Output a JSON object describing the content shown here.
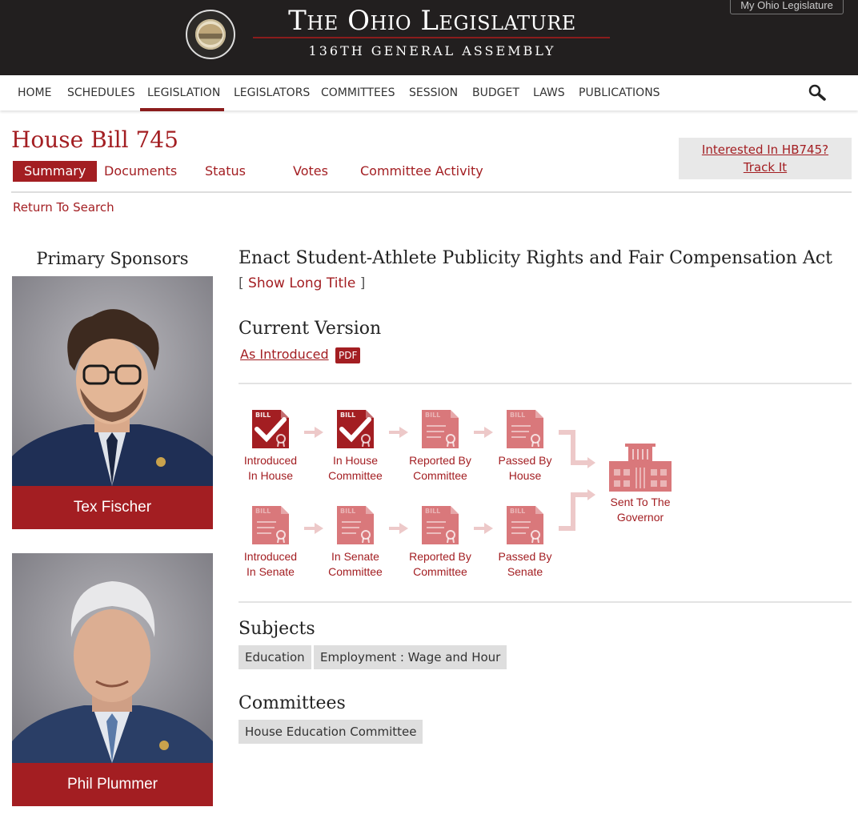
{
  "header": {
    "title": "The Ohio Legislature",
    "subtitle": "136TH GENERAL ASSEMBLY",
    "account_link": "My Ohio Legislature"
  },
  "nav": {
    "items": [
      "HOME",
      "SCHEDULES",
      "LEGISLATION",
      "LEGISLATORS",
      "COMMITTEES",
      "SESSION",
      "BUDGET",
      "LAWS",
      "PUBLICATIONS"
    ],
    "active": "LEGISLATION"
  },
  "bill": {
    "title": "House Bill 745",
    "tabs": [
      "Summary",
      "Documents",
      "Status",
      "Votes",
      "Committee Activity"
    ],
    "active_tab": "Summary",
    "track": {
      "line1": "Interested In HB745?",
      "line2": "Track It"
    },
    "return_link": "Return To Search"
  },
  "sponsors": {
    "heading": "Primary Sponsors",
    "people": [
      {
        "name": "Tex Fischer"
      },
      {
        "name": "Phil Plummer"
      }
    ]
  },
  "summary": {
    "short_title": "Enact Student-Athlete Publicity Rights and Fair Compensation Act",
    "long_title_open": "[",
    "long_title_link": "Show Long Title",
    "long_title_close": "]",
    "current_version_heading": "Current Version",
    "version_link": "As Introduced",
    "pdf_badge": "PDF"
  },
  "status": {
    "house": [
      {
        "line1": "Introduced",
        "line2": "In House",
        "complete": true
      },
      {
        "line1": "In House",
        "line2": "Committee",
        "complete": true
      },
      {
        "line1": "Reported By",
        "line2": "Committee",
        "complete": false
      },
      {
        "line1": "Passed By",
        "line2": "House",
        "complete": false
      }
    ],
    "senate": [
      {
        "line1": "Introduced",
        "line2": "In Senate",
        "complete": false
      },
      {
        "line1": "In Senate",
        "line2": "Committee",
        "complete": false
      },
      {
        "line1": "Reported By",
        "line2": "Committee",
        "complete": false
      },
      {
        "line1": "Passed By",
        "line2": "Senate",
        "complete": false
      }
    ],
    "final": {
      "line1": "Sent To The",
      "line2": "Governor",
      "complete": false
    },
    "icon_text": "BILL",
    "colors": {
      "complete": "#a31e22",
      "pending": "#d9787b",
      "arrow": "#edc9c9"
    }
  },
  "subjects": {
    "heading": "Subjects",
    "tags": [
      "Education",
      "Employment : Wage and Hour"
    ]
  },
  "committees": {
    "heading": "Committees",
    "tags": [
      "House Education Committee"
    ]
  }
}
